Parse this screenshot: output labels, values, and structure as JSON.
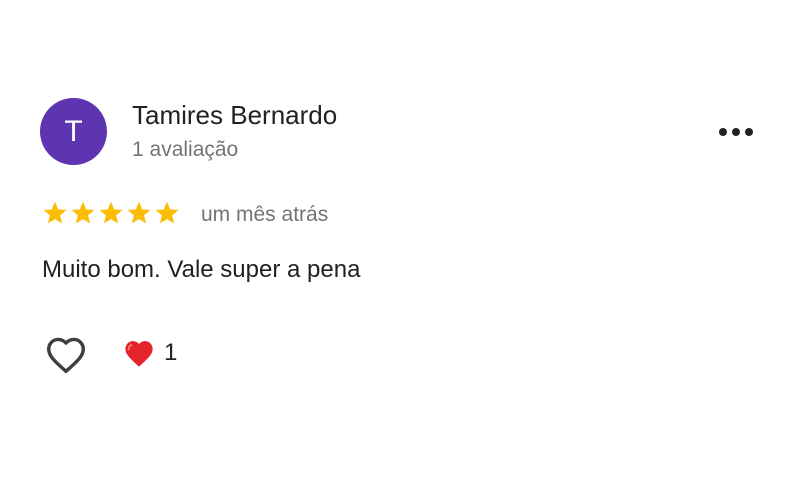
{
  "review": {
    "author": {
      "initial": "T",
      "name": "Tamires Bernardo",
      "review_count": "1 avaliação",
      "avatar_color": "#5e35b1"
    },
    "rating": 5,
    "star_color": "#fbbc04",
    "time_ago": "um mês atrás",
    "text": "Muito bom. Vale super a pena",
    "reactions": {
      "heart_count": "1",
      "heart_color": "#e3242b"
    },
    "icons": {
      "more": "more-horizontal-icon",
      "like": "heart-outline-icon",
      "reaction": "red-heart-icon"
    }
  }
}
